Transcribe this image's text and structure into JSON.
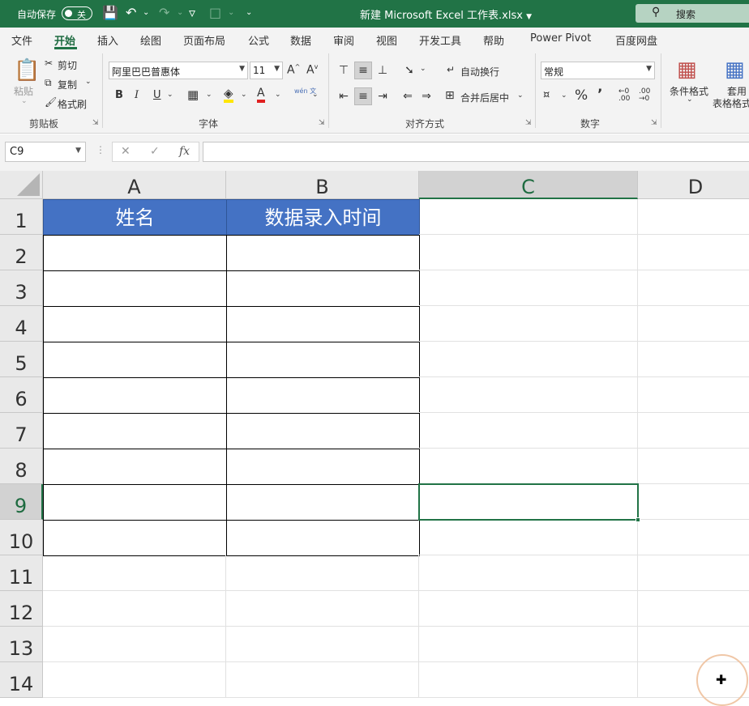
{
  "titlebar": {
    "autosave_label": "自动保存",
    "autosave_state": "关",
    "doc_title": "新建 Microsoft Excel 工作表.xlsx",
    "search_label": "搜索",
    "bg_color": "#217346"
  },
  "menu": {
    "tabs": [
      "文件",
      "开始",
      "插入",
      "绘图",
      "页面布局",
      "公式",
      "数据",
      "审阅",
      "视图",
      "开发工具",
      "帮助",
      "Power Pivot",
      "百度网盘"
    ],
    "active": "开始"
  },
  "ribbon": {
    "clipboard": {
      "paste": "粘贴",
      "cut": "剪切",
      "copy": "复制",
      "format_painter": "格式刷",
      "group": "剪贴板"
    },
    "font": {
      "name": "阿里巴巴普惠体",
      "size": "11",
      "bold": "B",
      "italic": "I",
      "underline": "U",
      "grow": "A^",
      "shrink": "Aˇ",
      "phonetic": "wén 文",
      "group": "字体"
    },
    "alignment": {
      "wrap": "自动换行",
      "merge": "合并后居中",
      "group": "对齐方式"
    },
    "number": {
      "format": "常规",
      "group": "数字"
    },
    "styles": {
      "conditional": "条件格式",
      "table_line1": "套用",
      "table_line2": "表格格式"
    }
  },
  "formula_bar": {
    "name_box": "C9",
    "fx": "fx",
    "value": ""
  },
  "sheet": {
    "columns": [
      "A",
      "B",
      "C",
      "D"
    ],
    "rows": [
      "1",
      "2",
      "3",
      "4",
      "5",
      "6",
      "7",
      "8",
      "9",
      "10",
      "11",
      "12",
      "13",
      "14"
    ],
    "header_cells": {
      "A1": "姓名",
      "B1": "数据录入时间"
    },
    "header_fill_color": "#4472c4",
    "selected_cell": "C9"
  }
}
